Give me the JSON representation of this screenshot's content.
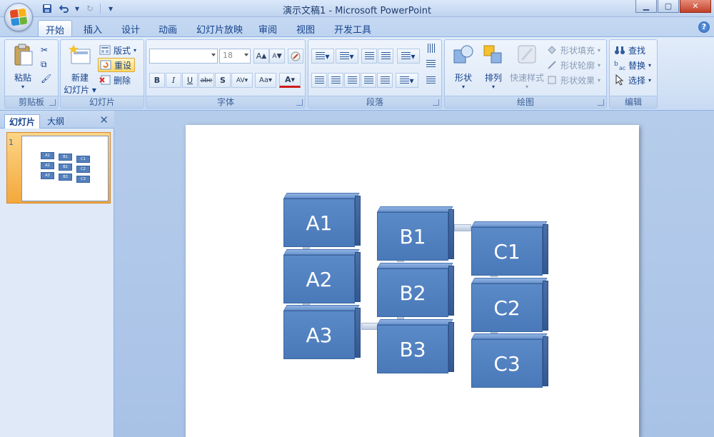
{
  "window": {
    "title": "演示文稿1 - Microsoft PowerPoint"
  },
  "tabs": [
    "开始",
    "插入",
    "设计",
    "动画",
    "幻灯片放映",
    "审阅",
    "视图",
    "开发工具"
  ],
  "clipboard": {
    "paste": "粘贴",
    "label": "剪贴板"
  },
  "slides_group": {
    "new_slide_line1": "新建",
    "new_slide_line2": "幻灯片",
    "layout": "版式",
    "reset": "重设",
    "delete": "删除",
    "label": "幻灯片"
  },
  "font": {
    "size": "18",
    "label": "字体",
    "bold": "B",
    "italic": "I",
    "underline": "U",
    "strike": "abe",
    "shadow": "S",
    "spacing": "AV",
    "case": "Aa",
    "color": "A",
    "grow": "A",
    "shrink": "A"
  },
  "paragraph": {
    "label": "段落"
  },
  "drawing": {
    "shapes": "形状",
    "arrange": "排列",
    "quick_styles": "快速样式",
    "fill": "形状填充",
    "outline": "形状轮廓",
    "effects": "形状效果",
    "label": "绘图"
  },
  "editing": {
    "find": "查找",
    "replace": "替换",
    "select": "选择",
    "label": "编辑"
  },
  "panel": {
    "tab_slides": "幻灯片",
    "tab_outline": "大纲",
    "slide_number": "1"
  },
  "diagram": {
    "blocks": [
      "A1",
      "A2",
      "A3",
      "B1",
      "B2",
      "B3",
      "C1",
      "C2",
      "C3"
    ]
  },
  "colors": {
    "block_face": "#4f7fc0",
    "block_side": "#3a5f99",
    "accent": "#15428b"
  }
}
